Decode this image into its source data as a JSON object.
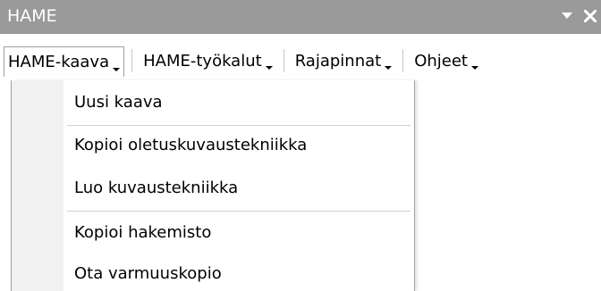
{
  "window": {
    "title": "HAME"
  },
  "titlebar": {
    "icons": [
      "chevron-down-icon",
      "close-icon"
    ]
  },
  "menubar": {
    "items": [
      {
        "label": "HAME-kaava"
      },
      {
        "label": "HAME-työkalut"
      },
      {
        "label": "Rajapinnat"
      },
      {
        "label": "Ohjeet"
      }
    ]
  },
  "dropdown": {
    "items": [
      {
        "label": "Uusi kaava"
      },
      {
        "label": "Kopioi oletuskuvaustekniikka"
      },
      {
        "label": "Luo kuvaustekniikka"
      },
      {
        "label": "Kopioi hakemisto"
      },
      {
        "label": "Ota varmuuskopio"
      }
    ]
  },
  "colors": {
    "titlebar_bg": "#9a9a9a",
    "titlebar_text": "#ffffff",
    "menu_text": "#000000",
    "separator": "#cfcfcf",
    "gutter": "#f1f1f1"
  }
}
